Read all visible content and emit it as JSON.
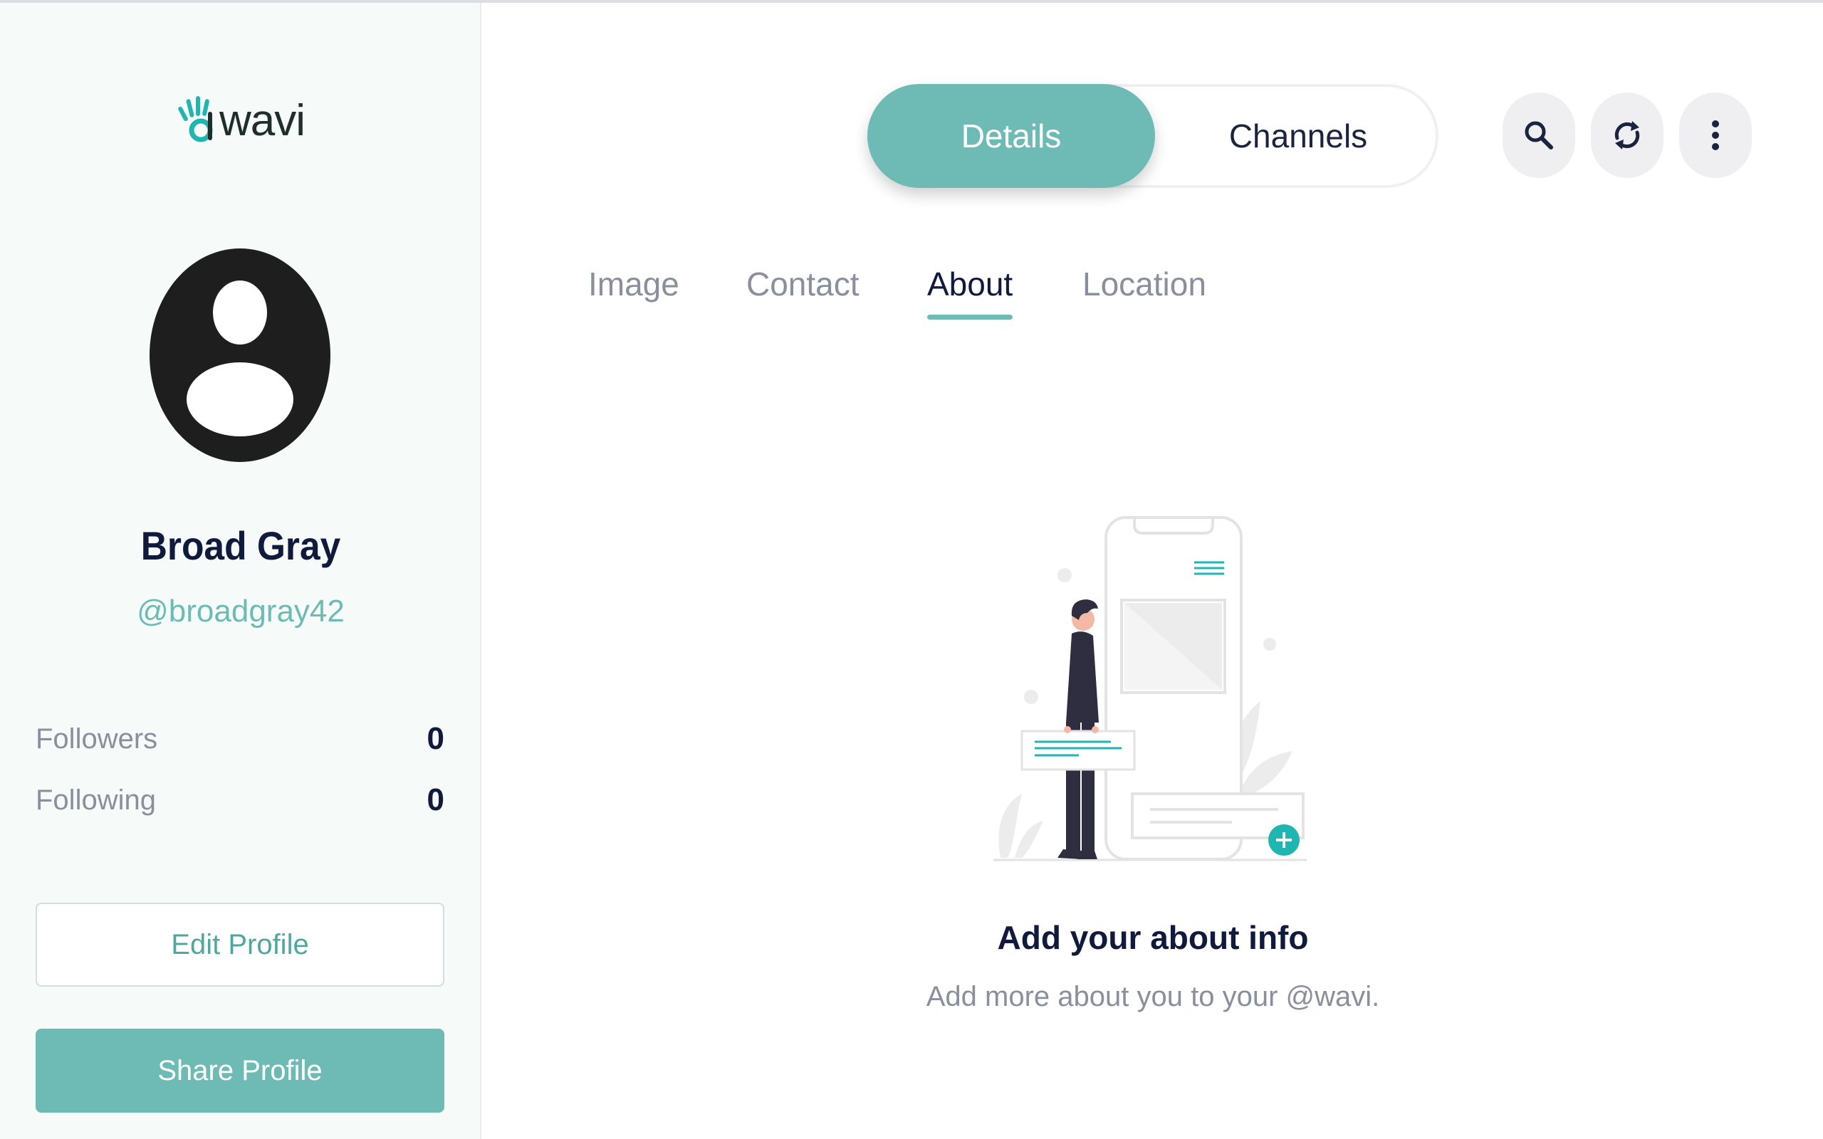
{
  "brand": {
    "name": "wavi"
  },
  "profile": {
    "name": "Broad Gray",
    "handle": "@broadgray42",
    "stats": [
      {
        "label": "Followers",
        "value": "0"
      },
      {
        "label": "Following",
        "value": "0"
      }
    ],
    "edit_label": "Edit Profile",
    "share_label": "Share Profile"
  },
  "header": {
    "segments": [
      {
        "label": "Details",
        "active": true
      },
      {
        "label": "Channels",
        "active": false
      }
    ],
    "icons": [
      "search-icon",
      "refresh-icon",
      "more-vertical-icon"
    ]
  },
  "tabs": [
    {
      "label": "Image",
      "active": false
    },
    {
      "label": "Contact",
      "active": false
    },
    {
      "label": "About",
      "active": true
    },
    {
      "label": "Location",
      "active": false
    }
  ],
  "empty_state": {
    "title": "Add your about info",
    "subtitle": "Add more about you to your @wavi."
  },
  "colors": {
    "accent": "#6dbbb4",
    "accent_dark": "#4fa89d",
    "heading": "#0f1a3d",
    "muted": "#8a8f9c",
    "sidebar_bg": "#f6fbfa",
    "illustration_teal": "#1fb5b0"
  }
}
